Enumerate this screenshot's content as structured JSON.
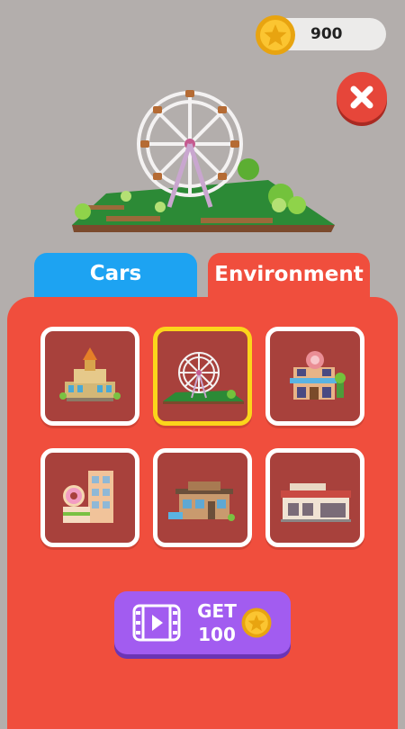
{
  "coins": {
    "amount": "900"
  },
  "tabs": [
    {
      "label": "Cars",
      "active": false,
      "color": "#1da3f2"
    },
    {
      "label": "Environment",
      "active": true,
      "color": "#f04e3d"
    }
  ],
  "preview_item": "ferris-wheel-park",
  "items": [
    {
      "name": "city-hall"
    },
    {
      "name": "ferris-wheel-park",
      "selected": true
    },
    {
      "name": "cafe-shop"
    },
    {
      "name": "donut-shop"
    },
    {
      "name": "restaurant"
    },
    {
      "name": "market"
    }
  ],
  "get_button": {
    "line1": "GET",
    "line2": "100",
    "icon": "video-icon"
  },
  "colors": {
    "accent": "#f04e3d",
    "selection": "#fbd51b",
    "button": "#a25cf0"
  }
}
